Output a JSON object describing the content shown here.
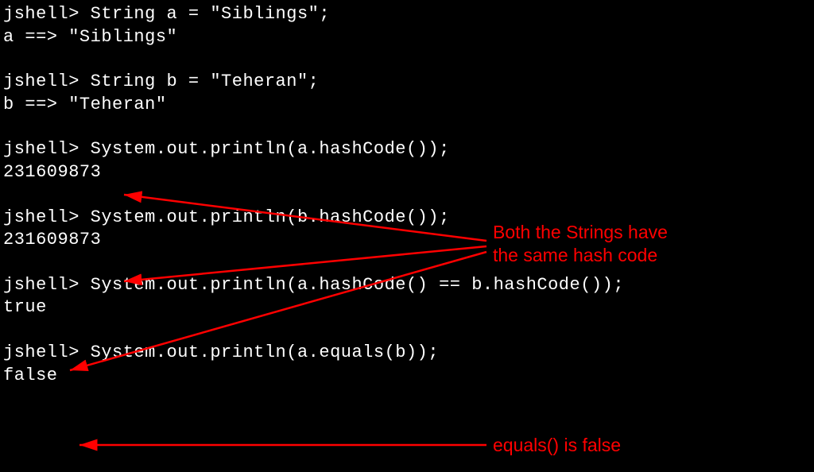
{
  "terminal": {
    "lines": [
      "jshell> String a = \"Siblings\";",
      "a ==> \"Siblings\"",
      "",
      "jshell> String b = \"Teheran\";",
      "b ==> \"Teheran\"",
      "",
      "jshell> System.out.println(a.hashCode());",
      "231609873",
      "",
      "jshell> System.out.println(b.hashCode());",
      "231609873",
      "",
      "jshell> System.out.println(a.hashCode() == b.hashCode());",
      "true",
      "",
      "jshell> System.out.println(a.equals(b));",
      "false"
    ]
  },
  "annotations": {
    "hashcode_note_line1": "Both the Strings have",
    "hashcode_note_line2": "the same hash code",
    "equals_note": "equals() is false"
  },
  "colors": {
    "bg": "#000000",
    "text": "#ffffff",
    "annotation": "#ff0000"
  }
}
